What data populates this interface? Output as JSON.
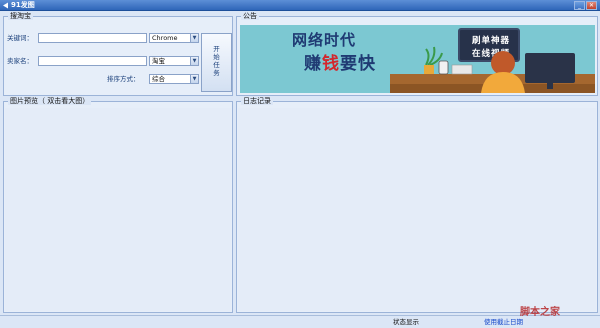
{
  "window": {
    "title": "91发图",
    "min_glyph": "_",
    "close_glyph": "✕"
  },
  "search_group": {
    "legend": "搜淘宝",
    "keyword_label": "关键词：",
    "keyword_value": "",
    "browser_select": "Chrome",
    "seller_label": "卖家名：",
    "seller_value": "",
    "platform_select": "淘宝",
    "sort_label": "排序方式：",
    "sort_select": "综合",
    "start_button": "开始任务"
  },
  "notice_group": {
    "legend": "公告",
    "banner_line1": "网络时代",
    "banner_line2_a": "赚",
    "banner_line2_b": "钱",
    "banner_line2_c": "要快",
    "sign_line1": "刷单神器",
    "sign_line2": "在线视频"
  },
  "preview_group": {
    "legend": "图片预览（ 双击看大图）"
  },
  "log_group": {
    "legend": "日志记录"
  },
  "statusbar": {
    "status": "状态显示",
    "expiry": "使用截止日期"
  },
  "watermark": "脚本之家",
  "colors": {
    "title_blue": "#2f66b8",
    "panel_bg": "#e4ecf8",
    "accent_red": "#d3262c",
    "banner_teal": "#7cc8d2"
  }
}
